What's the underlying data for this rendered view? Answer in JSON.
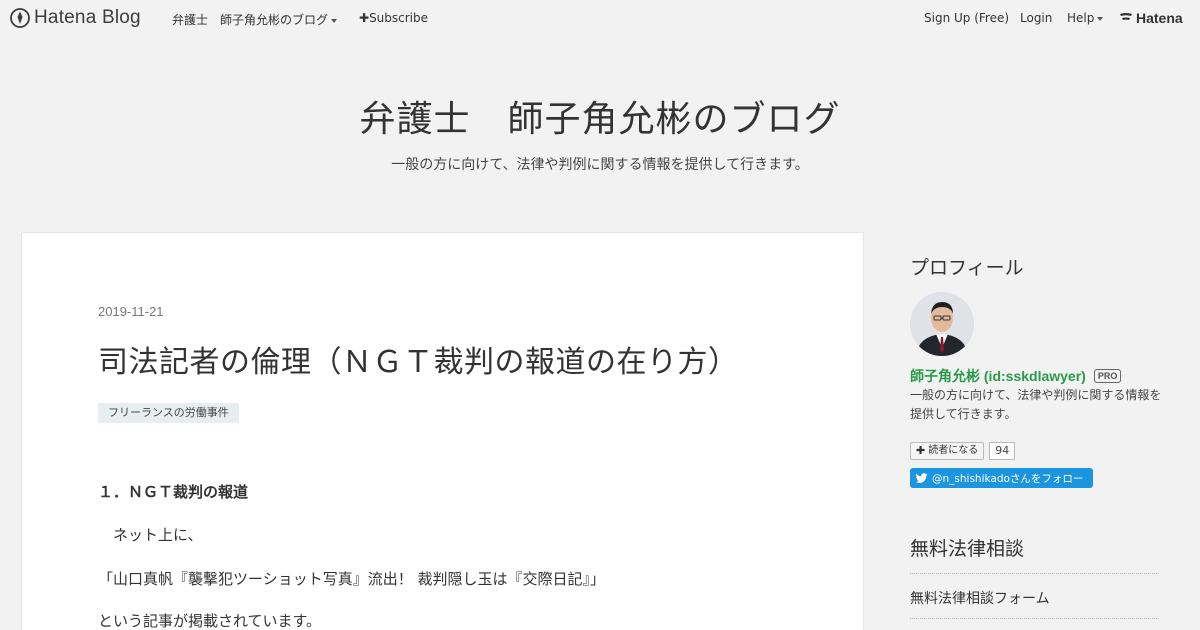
{
  "global_header": {
    "logo_text": "Hatena Blog",
    "blog_link": "弁護士　師子角允彬のブログ",
    "subscribe_label": "Subscribe",
    "signup_label": "Sign Up (Free)",
    "login_label": "Login",
    "help_label": "Help",
    "brand": "Hatena"
  },
  "blog": {
    "title": "弁護士　師子角允彬のブログ",
    "description": "一般の方に向けて、法律や判例に関する情報を提供して行きます。"
  },
  "entry": {
    "date": "2019-11-21",
    "title": "司法記者の倫理（ＮＧＴ裁判の報道の在り方）",
    "category": "フリーランスの労働事件",
    "heading": "１．ＮＧＴ裁判の報道",
    "paragraphs": [
      "　ネット上に、",
      "「山口真帆『襲撃犯ツーショット写真』流出！ 裁判隠し玉は『交際日記』」",
      "という記事が掲載されています。"
    ]
  },
  "sidebar": {
    "profile_title": "プロフィール",
    "profile_name": "師子角允彬 (id:sskdlawyer)",
    "pro_badge": "PRO",
    "profile_description": "一般の方に向けて、法律や判例に関する情報を提供して行きます。",
    "reader_button": "読者になる",
    "reader_count": "94",
    "twitter_follow": "@n_shishikadoさんをフォロー",
    "consult_title": "無料法律相談",
    "consult_link": "無料法律相談フォーム"
  },
  "colors": {
    "background": "#f2f2f2",
    "card": "#ffffff",
    "profile_name": "#2a9a4a",
    "twitter": "#1b95e0",
    "category_tag": "#e6eef1"
  }
}
